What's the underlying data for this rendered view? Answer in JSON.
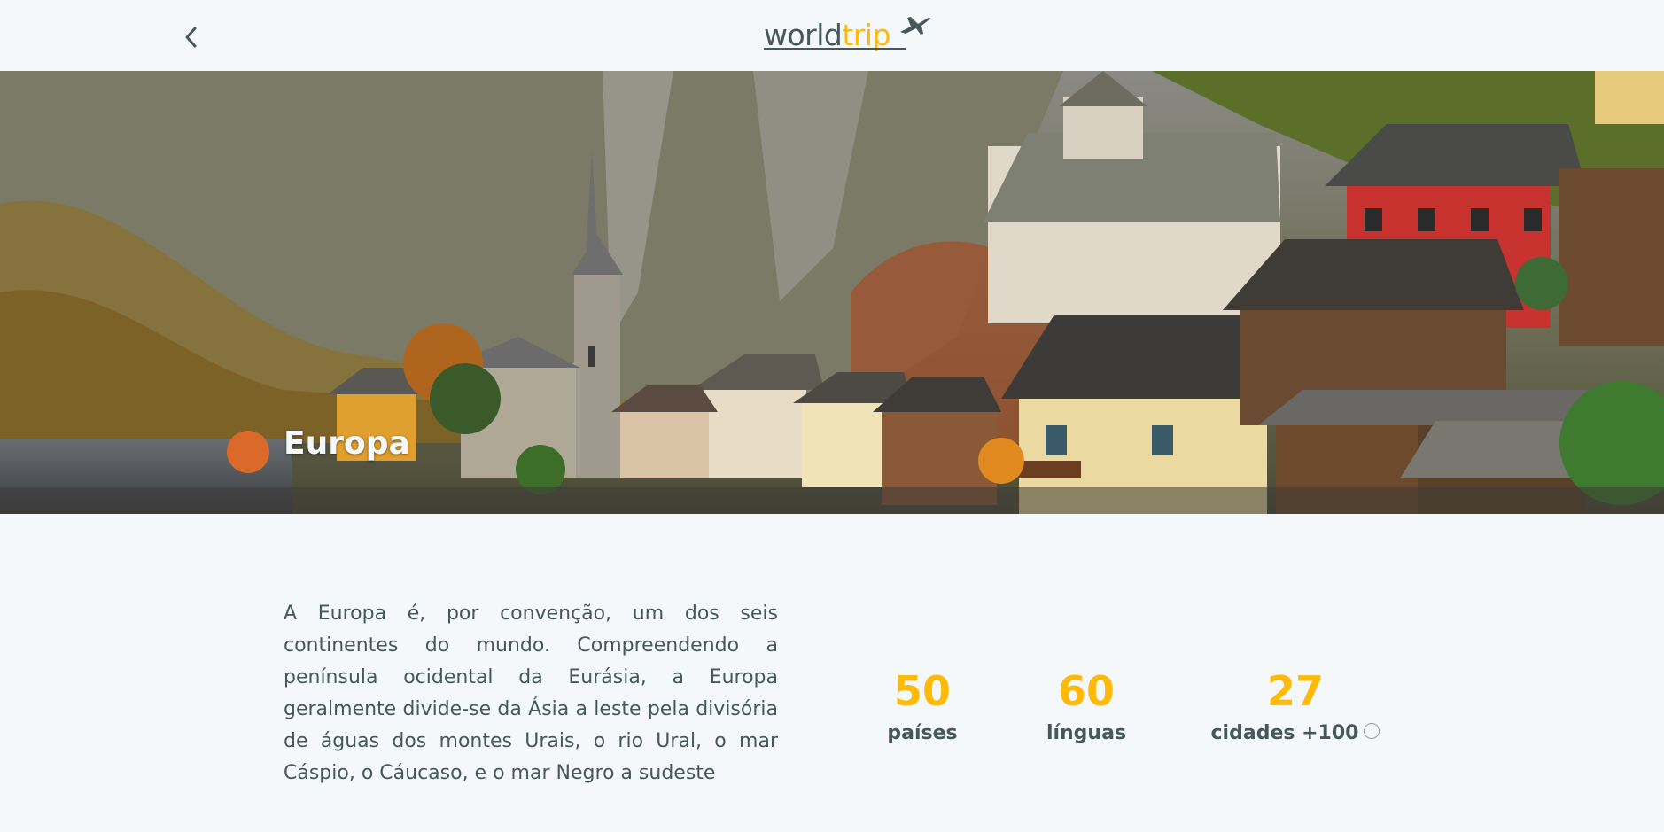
{
  "header": {
    "back_icon": "chevron-left-icon",
    "logo": {
      "part1": "world",
      "part2": "trip",
      "icon": "airplane-icon"
    }
  },
  "banner": {
    "title": "Europa"
  },
  "description": "A Europa é, por convenção, um dos seis continentes do mundo. Compreendendo a península ocidental da Eurásia, a Europa geralmente divide-se da Ásia a leste pela divisória de águas dos montes Urais, o rio Ural, o mar Cáspio, o Cáucaso, e o mar Negro a sudeste",
  "stats": [
    {
      "number": "50",
      "label": "países"
    },
    {
      "number": "60",
      "label": "línguas"
    },
    {
      "number": "27",
      "label": "cidades +100",
      "info_icon": "info-icon"
    }
  ],
  "colors": {
    "accent": "#FFBA08",
    "text": "#47585B",
    "background": "#F5F8FA"
  }
}
